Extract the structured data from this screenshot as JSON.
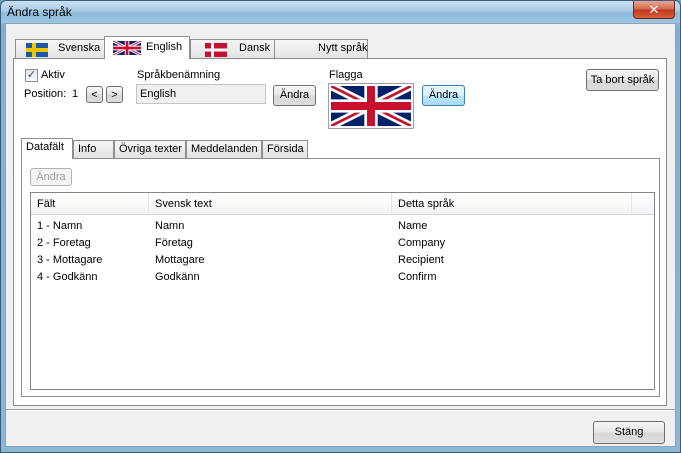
{
  "window": {
    "title": "Ändra språk",
    "close_glyph": "✕"
  },
  "language_tabs": [
    {
      "label": "Svenska",
      "flag": "se-flag"
    },
    {
      "label": "English",
      "flag": "gb-flag",
      "active": true
    },
    {
      "label": "Dansk",
      "flag": "dk-flag"
    },
    {
      "label": "Nytt språk"
    }
  ],
  "form": {
    "active_label": "Aktiv",
    "active_checked": true,
    "position_label": "Position:",
    "position_value": "1",
    "prev_glyph": "<",
    "next_glyph": ">",
    "name_label": "Språkbenämning",
    "name_value": "English",
    "name_change_button": "Ändra",
    "flag_label": "Flagga",
    "flag_change_button": "Ändra",
    "delete_button": "Ta bort språk"
  },
  "inner_tabs": [
    {
      "label": "Datafält",
      "active": true
    },
    {
      "label": "Info"
    },
    {
      "label": "Övriga texter"
    },
    {
      "label": "Meddelanden"
    },
    {
      "label": "Försida"
    }
  ],
  "datafields": {
    "change_button": "Ändra",
    "columns": [
      "Fält",
      "Svensk text",
      "Detta språk"
    ],
    "rows": [
      [
        "1 - Namn",
        "Namn",
        "Name"
      ],
      [
        "2 - Foretag",
        "Företag",
        "Company"
      ],
      [
        "3 - Mottagare",
        "Mottagare",
        "Recipient"
      ],
      [
        "4 - Godkänn",
        "Godkänn",
        "Confirm"
      ]
    ]
  },
  "footer": {
    "close_button": "Stäng"
  },
  "colors": {
    "se_blue": "#1a5aa6",
    "se_yellow": "#f5c400",
    "dk_red": "#c8102e",
    "gb_blue": "#012169",
    "gb_red": "#c8102e"
  }
}
